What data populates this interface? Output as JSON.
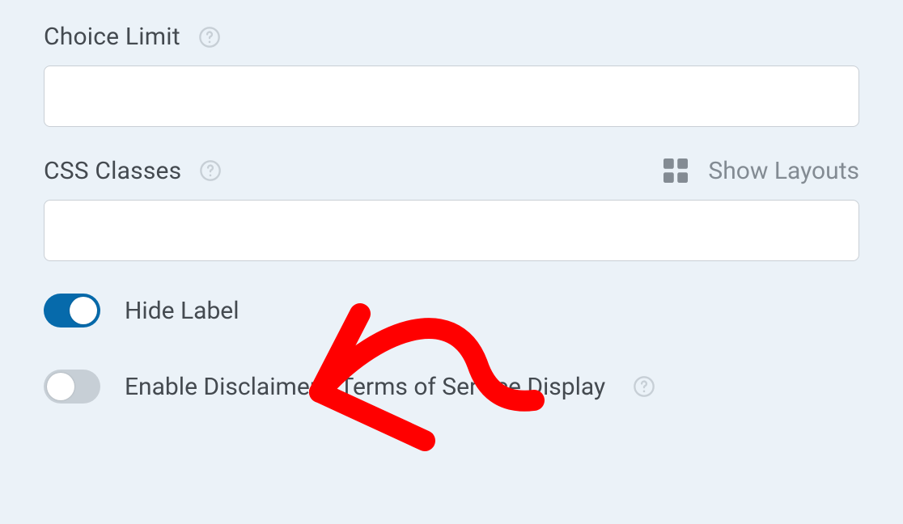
{
  "fields": {
    "choice_limit": {
      "label": "Choice Limit",
      "value": ""
    },
    "css_classes": {
      "label": "CSS Classes",
      "value": "",
      "show_layouts_label": "Show Layouts"
    }
  },
  "toggles": {
    "hide_label": {
      "label": "Hide Label",
      "on": true
    },
    "enable_disclaimer": {
      "label": "Enable Disclaimer / Terms of Service Display",
      "on": false
    }
  },
  "icons": {
    "help": "question-circle",
    "grid": "grid-4"
  },
  "annotation": {
    "type": "arrow",
    "color": "#ff0000"
  }
}
